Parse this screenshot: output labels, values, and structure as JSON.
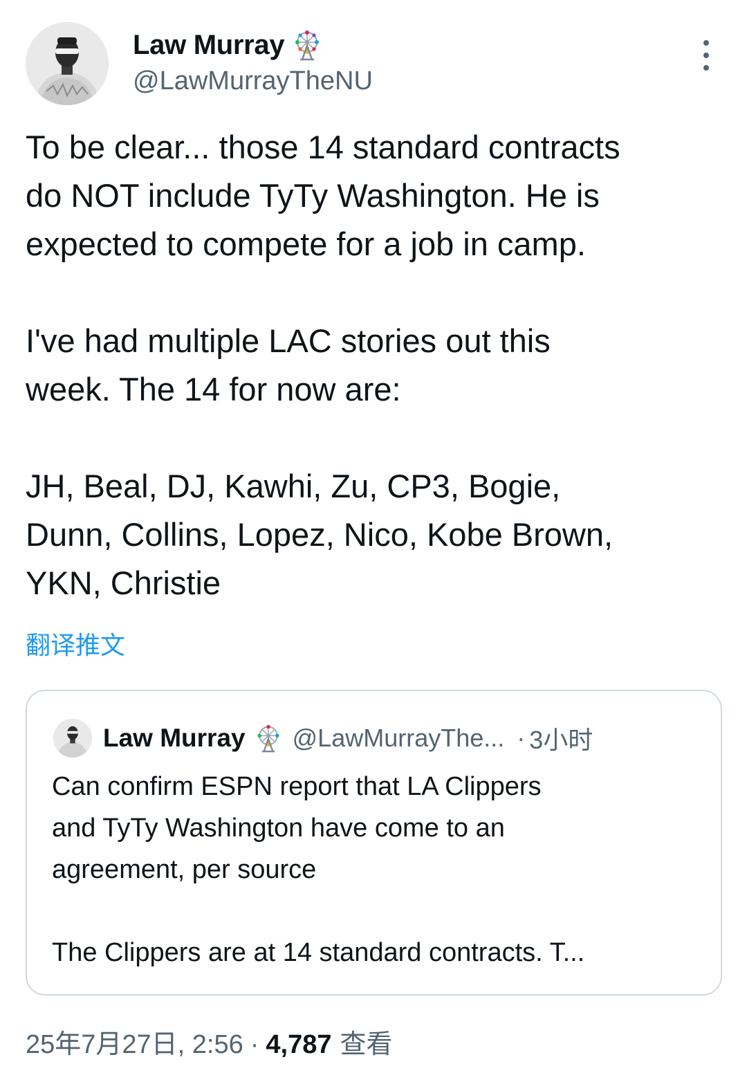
{
  "author": {
    "display_name": "Law Murray",
    "handle": "@LawMurrayTheNU",
    "badge_icon": "ferris-wheel-icon"
  },
  "tweet": {
    "paragraph1": [
      "To be clear... those 14 standard contracts",
      "do NOT include TyTy Washington. He is",
      "expected to compete for a job in camp."
    ],
    "paragraph2": [
      "I've had multiple LAC stories out this",
      "week. The 14 for now are:"
    ],
    "paragraph3": [
      "JH, Beal, DJ, Kawhi, Zu, CP3, Bogie,",
      "Dunn, Collins, Lopez, Nico, Kobe Brown,",
      "YKN, Christie"
    ],
    "translate_label": "翻译推文"
  },
  "quoted_tweet": {
    "display_name": "Law Murray",
    "handle": "@LawMurrayThe...",
    "separator": "·",
    "time": "3小时",
    "paragraph1": [
      "Can confirm ESPN report that LA Clippers",
      "and TyTy Washington have come to an",
      "agreement, per source"
    ],
    "paragraph2": [
      "The Clippers are at 14 standard contracts. T..."
    ]
  },
  "meta": {
    "date_time": "25年7月27日, 2:56",
    "separator": "·",
    "views_count": "4,787",
    "views_label": "查看"
  },
  "colors": {
    "text_primary": "#0f1419",
    "text_secondary": "#536471",
    "link": "#1d9bf0",
    "border": "#cfd9de"
  }
}
